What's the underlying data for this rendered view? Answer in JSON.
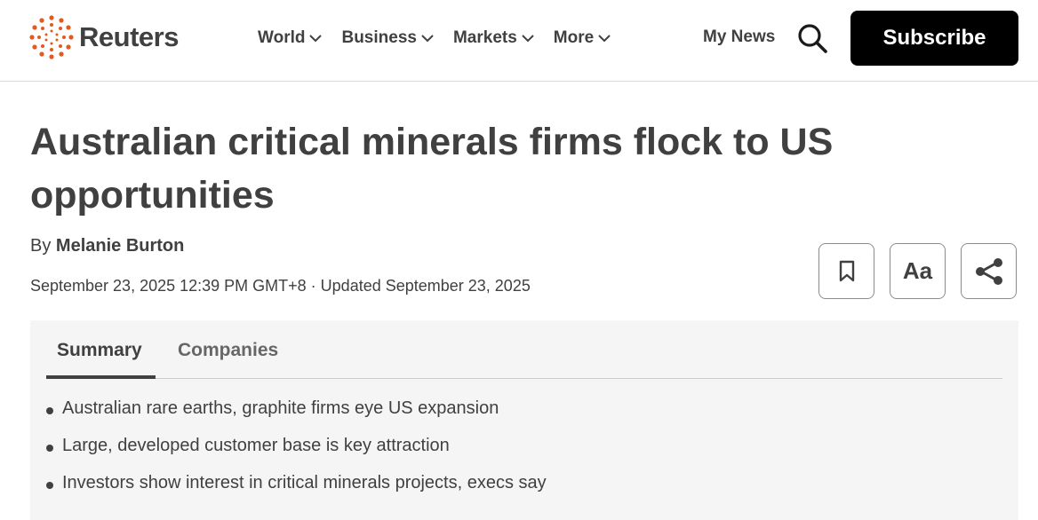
{
  "header": {
    "logo_text": "Reuters",
    "logo_color": "#e25a1c",
    "nav": [
      {
        "label": "World"
      },
      {
        "label": "Business"
      },
      {
        "label": "Markets"
      },
      {
        "label": "More"
      }
    ],
    "my_news": "My News",
    "search_icon": "search-icon",
    "subscribe_label": "Subscribe"
  },
  "article": {
    "headline": "Australian critical minerals firms flock to US opportunities",
    "by_prefix": "By",
    "author": "Melanie Burton",
    "dateline": "September 23, 2025 12:39 PM GMT+8 · Updated September 23, 2025",
    "actions": {
      "bookmark_icon": "bookmark-icon",
      "text_size_label": "Aa",
      "share_icon": "share-icon"
    }
  },
  "summary_panel": {
    "tabs": [
      {
        "label": "Summary",
        "active": true
      },
      {
        "label": "Companies",
        "active": false
      }
    ],
    "bullets": [
      "Australian rare earths, graphite firms eye US expansion",
      "Large, developed customer base is key attraction",
      "Investors show interest in critical minerals projects, execs say"
    ]
  }
}
